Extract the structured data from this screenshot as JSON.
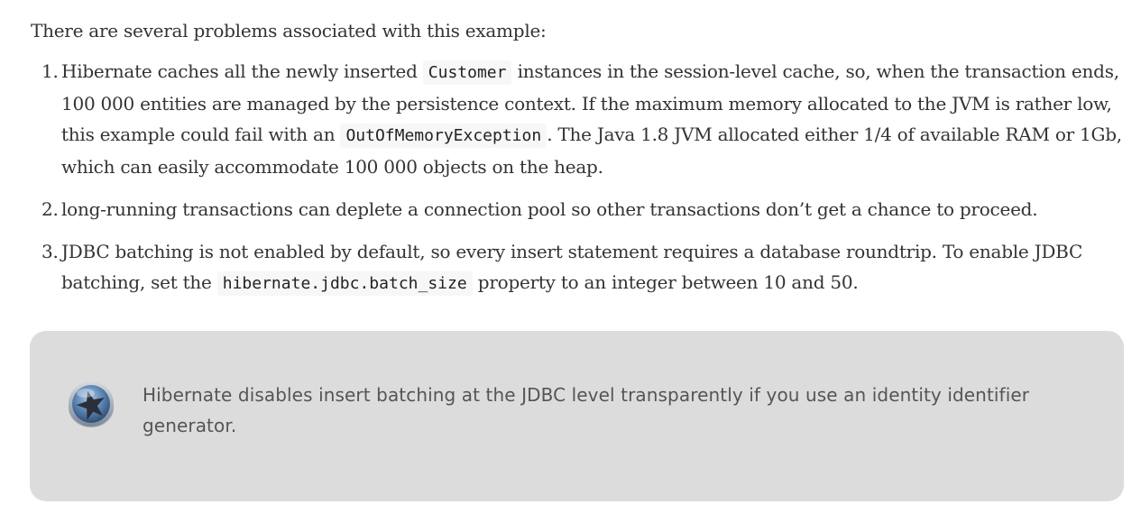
{
  "intro": "There are several problems associated with this example:",
  "problems": [
    {
      "num": "1.",
      "t1": "Hibernate caches all the newly inserted ",
      "c1": "Customer",
      "t2": " instances in the session-level cache, so, when the transaction ends, 100 000 entities are managed by the persistence context. If the maximum memory allocated to the JVM is rather low, this example could fail with an ",
      "c2": "OutOfMemoryException",
      "t3": ". The Java 1.8 JVM allocated either 1/4 of available RAM or 1Gb, which can easily accommodate 100 000 objects on the heap."
    },
    {
      "num": "2.",
      "text": "long-running transactions can deplete a connection pool so other transactions don’t get a chance to proceed."
    },
    {
      "num": "3.",
      "t1": "JDBC batching is not enabled by default, so every insert statement requires a database roundtrip. To enable JDBC batching, set the ",
      "c1": "hibernate.jdbc.batch_size",
      "t2": " property to an integer between 10 and 50."
    }
  ],
  "tip": {
    "icon": "tip-icon",
    "text": "Hibernate disables insert batching at the JDBC level transparently if you use an identity identifier generator."
  },
  "colors": {
    "body_text": "#333333",
    "code_background": "#f7f7f8",
    "tip_background": "#dcdcdc",
    "tip_text": "#555555",
    "icon_blue": "#4b6f96"
  }
}
